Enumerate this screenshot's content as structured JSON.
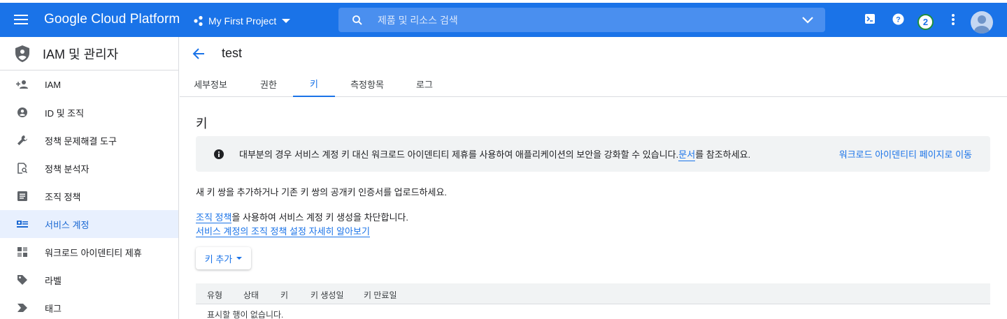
{
  "topbar": {
    "brand": "Google Cloud Platform",
    "project": "My First Project",
    "search_placeholder": "제품 및 리소스 검색",
    "notification_count": "2",
    "accent": "#1a73e8"
  },
  "sidebar": {
    "title": "IAM 및 관리자",
    "items": [
      {
        "label": "IAM",
        "icon": "person-add-icon"
      },
      {
        "label": "ID 및 조직",
        "icon": "account-circle-icon"
      },
      {
        "label": "정책 문제해결 도구",
        "icon": "wrench-icon"
      },
      {
        "label": "정책 분석자",
        "icon": "policy-analyzer-icon"
      },
      {
        "label": "조직 정책",
        "icon": "list-icon"
      },
      {
        "label": "서비스 계정",
        "icon": "service-account-icon",
        "active": true
      },
      {
        "label": "워크로드 아이덴티티 제휴",
        "icon": "workload-identity-icon"
      },
      {
        "label": "라벨",
        "icon": "label-icon"
      },
      {
        "label": "태그",
        "icon": "tag-icon"
      }
    ]
  },
  "main": {
    "title": "test",
    "tabs": [
      {
        "label": "세부정보"
      },
      {
        "label": "권한"
      },
      {
        "label": "키",
        "active": true
      },
      {
        "label": "측정항목"
      },
      {
        "label": "로그"
      }
    ],
    "section_title": "키",
    "info": {
      "text_before": "대부분의 경우 서비스 계정 키 대신 워크로드 아이덴티티 제휴를 사용하여 애플리케이션의 보안을 강화할 수 있습니다. ",
      "link": "문서",
      "text_after": "를 참조하세요.",
      "action": "워크로드 아이덴티티 페이지로 이동"
    },
    "para1": "새 키 쌍을 추가하거나 기존 키 쌍의 공개키 인증서를 업로드하세요.",
    "para2_link": "조직 정책",
    "para2_text": "을 사용하여 서비스 계정 키 생성을 차단합니다.",
    "para3_link": "서비스 계정의 조직 정책 설정 자세히 알아보기",
    "add_key_button": "키 추가",
    "table": {
      "columns": [
        "유형",
        "상태",
        "키",
        "키 생성일",
        "키 만료일"
      ],
      "empty_text": "표시할 행이 없습니다."
    }
  }
}
